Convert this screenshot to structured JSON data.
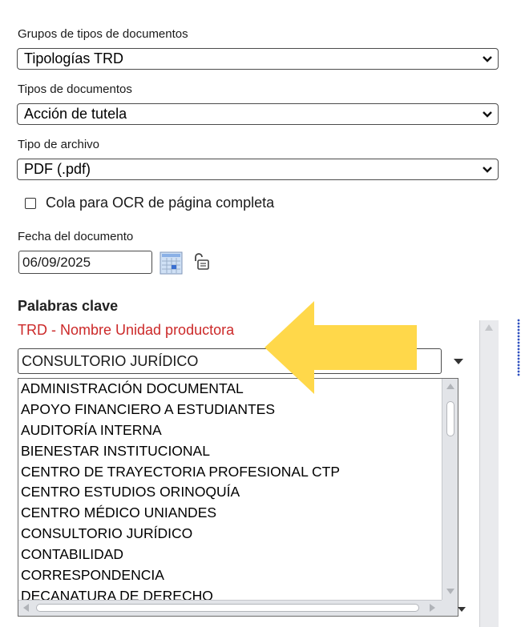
{
  "form": {
    "doc_type_groups": {
      "label": "Grupos de tipos de documentos",
      "value": "Tipologías TRD"
    },
    "doc_types": {
      "label": "Tipos de documentos",
      "value": "Acción de tutela"
    },
    "file_type": {
      "label": "Tipo de archivo",
      "value": "PDF (.pdf)"
    },
    "ocr_checkbox": {
      "label": "Cola para OCR de página completa",
      "checked": false
    },
    "document_date": {
      "label": "Fecha del documento",
      "value": "06/09/2025"
    }
  },
  "keywords": {
    "title": "Palabras clave",
    "field_label": "TRD - Nombre Unidad productora",
    "field_label_color": "#cc2929",
    "selected_value": "CONSULTORIO JURÍDICO",
    "options": [
      "ADMINISTRACIÓN DOCUMENTAL",
      "APOYO FINANCIERO A ESTUDIANTES",
      "AUDITORÍA INTERNA",
      "BIENESTAR INSTITUCIONAL",
      "CENTRO DE TRAYECTORIA PROFESIONAL CTP",
      "CENTRO ESTUDIOS ORINOQUÍA",
      "CENTRO MÉDICO UNIANDES",
      "CONSULTORIO JURÍDICO",
      "CONTABILIDAD",
      "CORRESPONDENCIA",
      "DECANATURA DE DERECHO"
    ]
  },
  "annotation": {
    "arrow_color": "#ffd84a",
    "icon": "arrow-left-icon"
  }
}
